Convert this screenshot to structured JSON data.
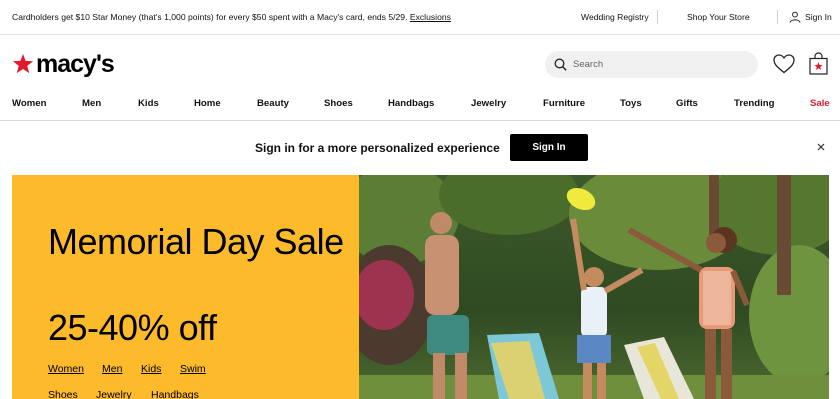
{
  "topbar": {
    "promo_text": "Cardholders get $10 Star Money (that's 1,000 points) for every $50 spent with a Macy's card, ends 5/29.",
    "promo_link": "Exclusions",
    "wedding_registry": "Wedding Registry",
    "shop_your_store": "Shop Your Store",
    "sign_in": "Sign In"
  },
  "header": {
    "logo_text": "macy's",
    "search_placeholder": "Search"
  },
  "nav": {
    "items": [
      "Women",
      "Men",
      "Kids",
      "Home",
      "Beauty",
      "Shoes",
      "Handbags",
      "Jewelry",
      "Furniture",
      "Toys",
      "Gifts",
      "Trending",
      "Sale"
    ]
  },
  "signin_banner": {
    "text": "Sign in for a more personalized experience",
    "button": "Sign In"
  },
  "hero": {
    "title": "Memorial Day Sale",
    "subtitle": "25-40% off",
    "links": [
      "Women",
      "Men",
      "Kids",
      "Swim",
      "Shoes",
      "Jewelry",
      "Handbags"
    ]
  },
  "colors": {
    "brand_red": "#e11a2b",
    "hero_yellow": "#fdbb2b"
  }
}
